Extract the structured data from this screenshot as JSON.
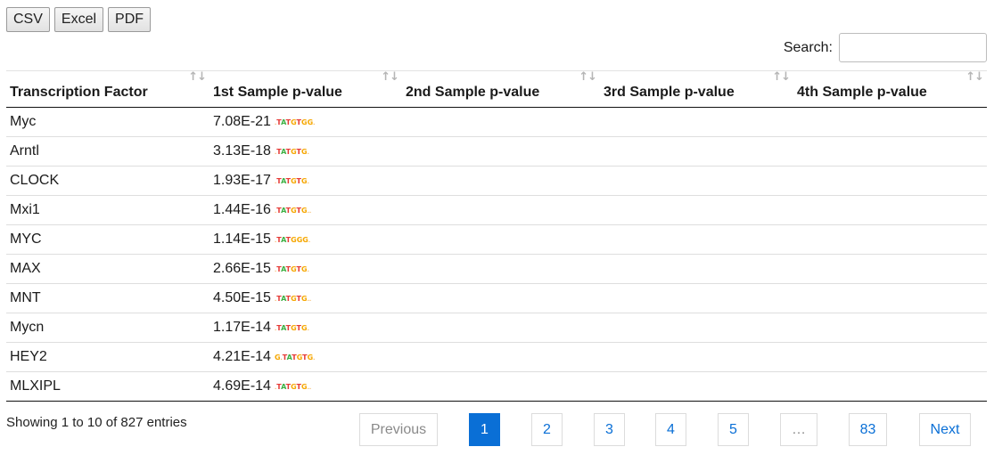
{
  "export_buttons": [
    "CSV",
    "Excel",
    "PDF"
  ],
  "search": {
    "label": "Search:",
    "value": "",
    "placeholder": ""
  },
  "table": {
    "headers": [
      "Transcription Factor",
      "1st Sample p-value",
      "2nd Sample p-value",
      "3rd Sample p-value",
      "4th Sample p-value"
    ],
    "rows": [
      {
        "tf": "Myc",
        "p1": "7.08E-21",
        "logo": "_TATGTGG_"
      },
      {
        "tf": "Arntl",
        "p1": "3.13E-18",
        "logo": "_TATGTG_"
      },
      {
        "tf": "CLOCK",
        "p1": "1.93E-17",
        "logo": "_TATGTG_"
      },
      {
        "tf": "Mxi1",
        "p1": "1.44E-16",
        "logo": "_TATGTG__"
      },
      {
        "tf": "MYC",
        "p1": "1.14E-15",
        "logo": "_TATGGG_"
      },
      {
        "tf": "MAX",
        "p1": "2.66E-15",
        "logo": "_TATGTG_"
      },
      {
        "tf": "MNT",
        "p1": "4.50E-15",
        "logo": "_TATGTG__"
      },
      {
        "tf": "Mycn",
        "p1": "1.17E-14",
        "logo": "_TATGTG_"
      },
      {
        "tf": "HEY2",
        "p1": "4.21E-14",
        "logo": "G_TATGTG_"
      },
      {
        "tf": "MLXIPL",
        "p1": "4.69E-14",
        "logo": "_TATGTG__"
      }
    ]
  },
  "info": "Showing 1 to 10 of 827 entries",
  "pagination": {
    "previous": "Previous",
    "pages": [
      "1",
      "2",
      "3",
      "4",
      "5",
      "…",
      "83"
    ],
    "next": "Next",
    "active": "1"
  }
}
